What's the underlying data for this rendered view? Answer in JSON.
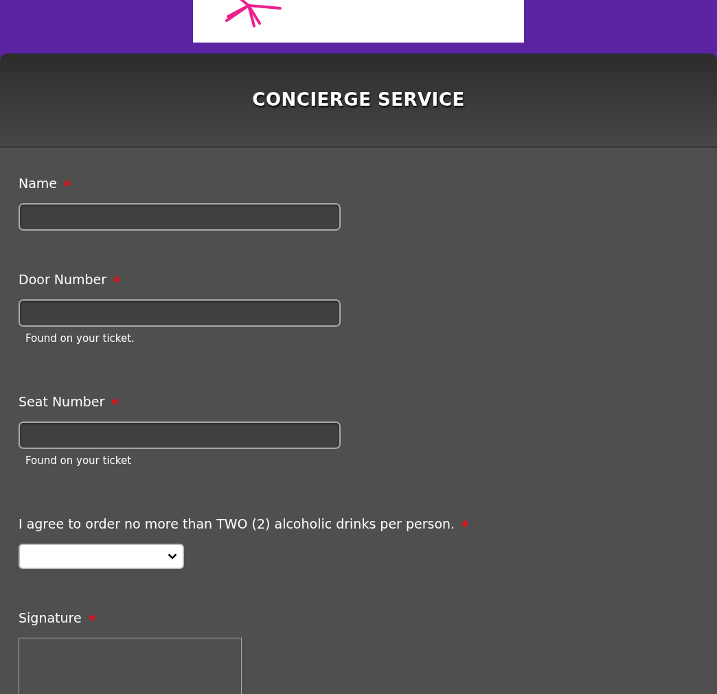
{
  "form": {
    "title": "CONCIERGE SERVICE",
    "fields": [
      {
        "kind": "text",
        "label": "Name",
        "required": true
      },
      {
        "kind": "text",
        "label": "Door Number",
        "required": true,
        "hint": "Found on your ticket."
      },
      {
        "kind": "text",
        "label": "Seat Number",
        "required": true,
        "hint": "Found on your ticket"
      },
      {
        "kind": "dropdown",
        "label": "I agree to order no more than TWO (2) alcoholic drinks per person.",
        "required": true
      },
      {
        "kind": "signature",
        "label": "Signature",
        "required": true
      }
    ]
  }
}
